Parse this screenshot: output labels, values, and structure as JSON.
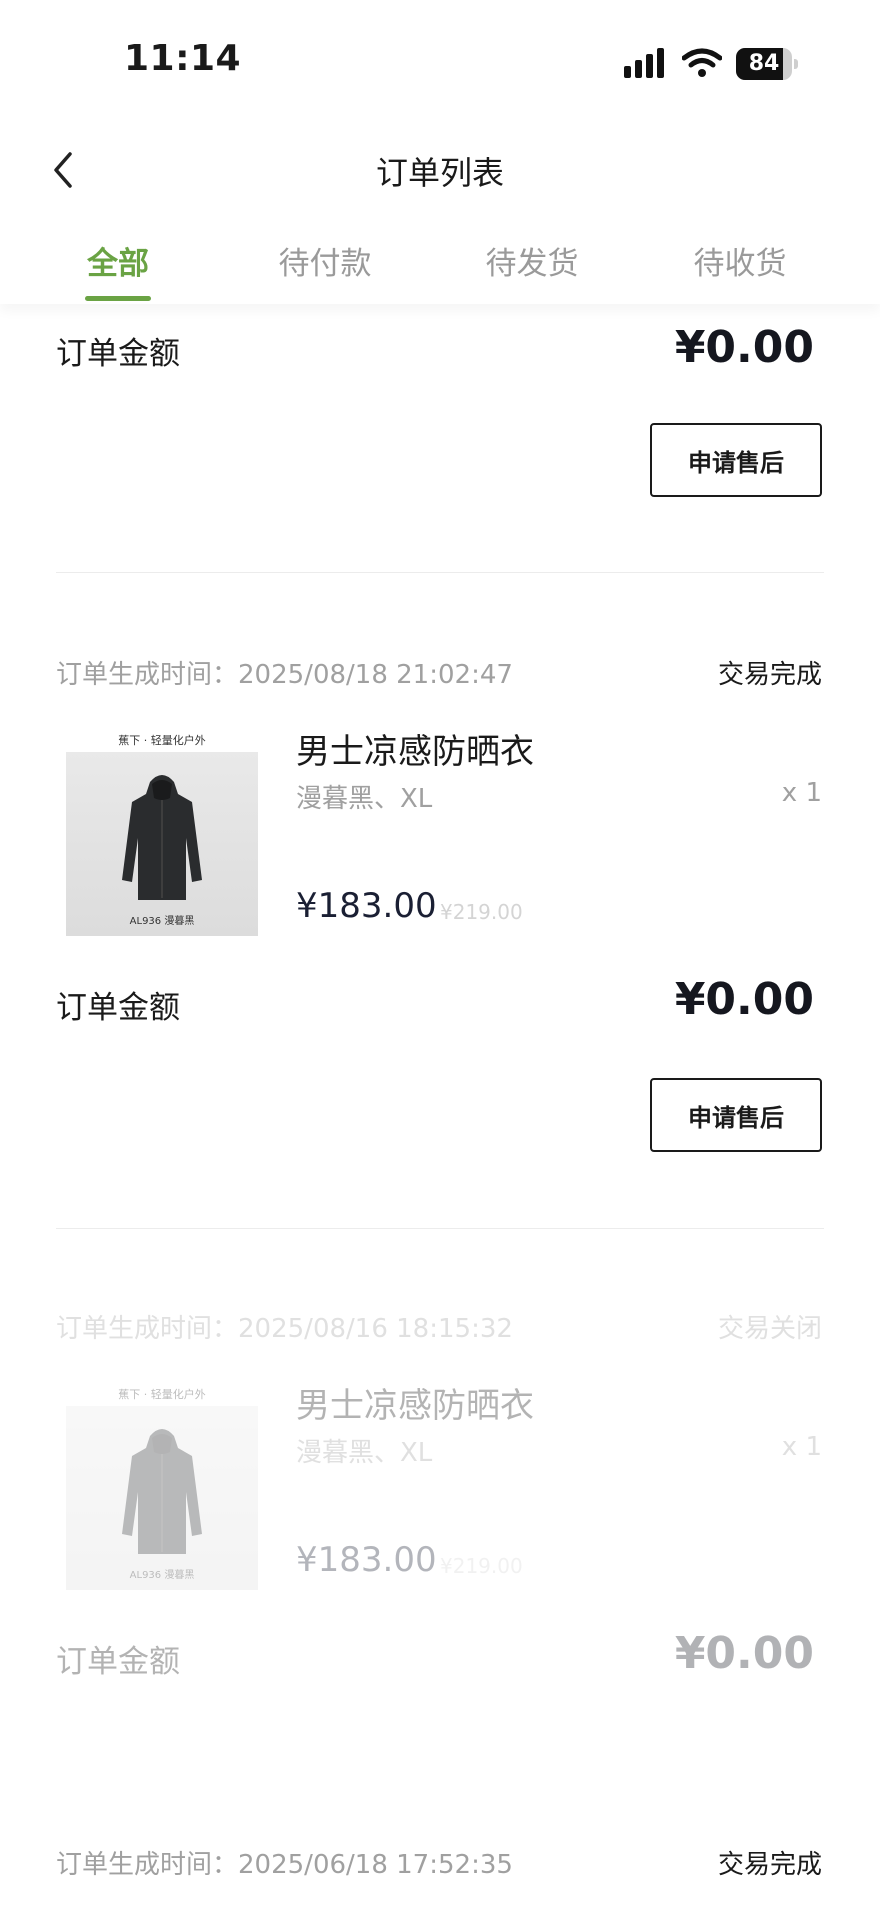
{
  "status_bar": {
    "time": "11:14",
    "battery": "84",
    "battery_level": 0.84
  },
  "header": {
    "title": "订单列表"
  },
  "tabs": [
    {
      "label": "全部",
      "active": true
    },
    {
      "label": "待付款",
      "active": false
    },
    {
      "label": "待发货",
      "active": false
    },
    {
      "label": "待收货",
      "active": false
    }
  ],
  "top_partial": {
    "total_label": "订单金额",
    "total_value": "¥0.00",
    "action": "申请售后"
  },
  "orders": [
    {
      "created_label": "订单生成时间：",
      "created_at": "2025/08/18 21:02:47",
      "status": "交易完成",
      "product": {
        "name": "男士凉感防晒衣",
        "spec": "漫暮黑、XL",
        "qty": "x 1",
        "price": "¥183.00",
        "original_price": "¥219.00",
        "thumb_brand": "蕉下 · 轻量化户外",
        "thumb_code": "AL936 漫暮黑"
      },
      "total_label": "订单金额",
      "total_value": "¥0.00",
      "action": "申请售后"
    },
    {
      "created_label": "订单生成时间：",
      "created_at": "2025/08/16 18:15:32",
      "status": "交易关闭",
      "product": {
        "name": "男士凉感防晒衣",
        "spec": "漫暮黑、XL",
        "qty": "x 1",
        "price": "¥183.00",
        "original_price": "¥219.00",
        "thumb_brand": "蕉下 · 轻量化户外",
        "thumb_code": "AL936 漫暮黑"
      },
      "total_label": "订单金额",
      "total_value": "¥0.00"
    },
    {
      "created_label": "订单生成时间：",
      "created_at": "2025/06/18 17:52:35",
      "status": "交易完成"
    }
  ],
  "colors": {
    "accent": "#6aa344",
    "text": "#1a1a1a",
    "muted": "#a0a0a0"
  }
}
